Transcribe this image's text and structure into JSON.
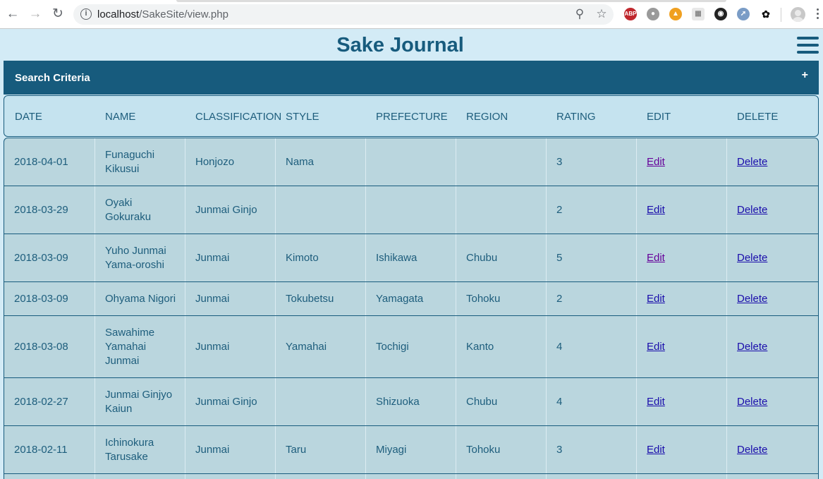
{
  "browser": {
    "url_host": "localhost",
    "url_path": "/SakeSite/view.php"
  },
  "page": {
    "title": "Sake Journal"
  },
  "search": {
    "title": "Search Criteria",
    "toggle": "+"
  },
  "table": {
    "columns": [
      "DATE",
      "NAME",
      "CLASSIFICATION",
      "STYLE",
      "PREFECTURE",
      "REGION",
      "RATING",
      "EDIT",
      "DELETE"
    ],
    "rows": [
      {
        "date": "2018-04-01",
        "name": "Funaguchi Kikusui",
        "classification": "Honjozo",
        "style": "Nama",
        "prefecture": "",
        "region": "",
        "rating": "3",
        "edit": "Edit",
        "delete": "Delete"
      },
      {
        "date": "2018-03-29",
        "name": "Oyaki Gokuraku",
        "classification": "Junmai Ginjo",
        "style": "",
        "prefecture": "",
        "region": "",
        "rating": "2",
        "edit": "Edit",
        "delete": "Delete"
      },
      {
        "date": "2018-03-09",
        "name": "Yuho Junmai Yama-oroshi",
        "classification": "Junmai",
        "style": "Kimoto",
        "prefecture": "Ishikawa",
        "region": "Chubu",
        "rating": "5",
        "edit": "Edit",
        "delete": "Delete"
      },
      {
        "date": "2018-03-09",
        "name": "Ohyama Nigori",
        "classification": "Junmai",
        "style": "Tokubetsu",
        "prefecture": "Yamagata",
        "region": "Tohoku",
        "rating": "2",
        "edit": "Edit",
        "delete": "Delete"
      },
      {
        "date": "2018-03-08",
        "name": "Sawahime Yamahai Junmai",
        "classification": "Junmai",
        "style": "Yamahai",
        "prefecture": "Tochigi",
        "region": "Kanto",
        "rating": "4",
        "edit": "Edit",
        "delete": "Delete"
      },
      {
        "date": "2018-02-27",
        "name": "Junmai Ginjyo Kaiun",
        "classification": "Junmai Ginjo",
        "style": "",
        "prefecture": "Shizuoka",
        "region": "Chubu",
        "rating": "4",
        "edit": "Edit",
        "delete": "Delete"
      },
      {
        "date": "2018-02-11",
        "name": "Ichinokura Tarusake",
        "classification": "Junmai",
        "style": "Taru",
        "prefecture": "Miyagi",
        "region": "Tohoku",
        "rating": "3",
        "edit": "Edit",
        "delete": "Delete"
      },
      {
        "date": "",
        "name": "",
        "classification": "",
        "style": "",
        "prefecture": "",
        "region": "",
        "rating": "",
        "edit": "",
        "delete": ""
      }
    ]
  }
}
